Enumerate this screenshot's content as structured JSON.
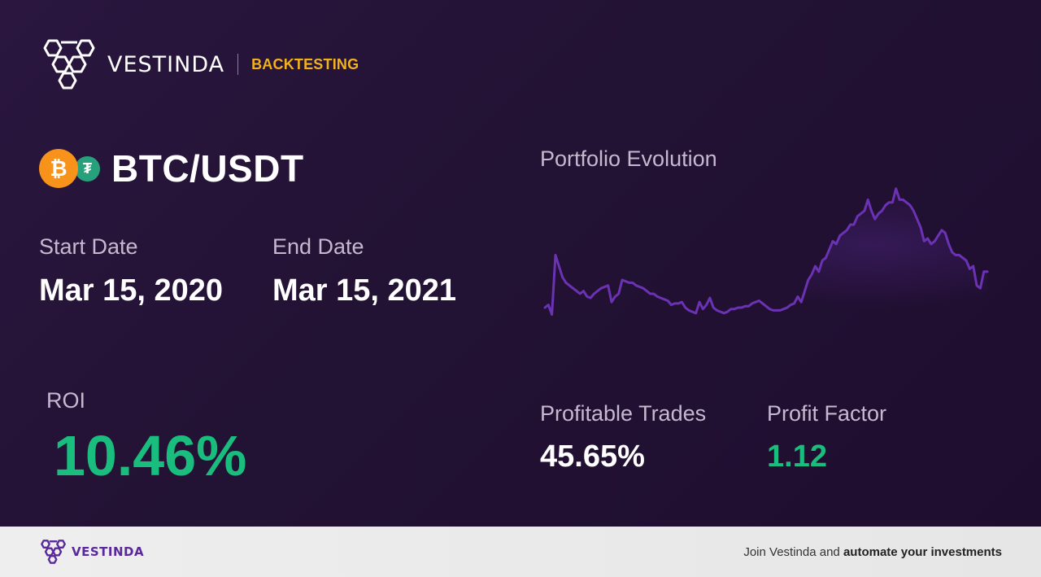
{
  "brand": {
    "name": "VESTINDA",
    "tag": "BACKTESTING",
    "tag_color": "#f2b21e"
  },
  "pair": {
    "name": "BTC/USDT",
    "base_icon": "bitcoin-icon",
    "base_glyph": "₿",
    "quote_icon": "tether-icon",
    "quote_glyph": "₮"
  },
  "dates": {
    "start_label": "Start Date",
    "start_value": "Mar 15, 2020",
    "end_label": "End Date",
    "end_value": "Mar 15, 2021"
  },
  "roi": {
    "label": "ROI",
    "value": "10.46%",
    "color": "#19be7e"
  },
  "stats": {
    "profitable_trades_label": "Profitable Trades",
    "profitable_trades_value": "45.65%",
    "profit_factor_label": "Profit Factor",
    "profit_factor_value": "1.12",
    "positive_color": "#19be7e"
  },
  "chart_data": {
    "type": "line",
    "title": "Portfolio Evolution",
    "xlabel": "",
    "ylabel": "",
    "grid": false,
    "line_color": "#6b32b4",
    "note": "No axes shown; values are relative portfolio level estimated from the line shape (arbitrary units, 0-100).",
    "ylim": [
      0,
      100
    ],
    "values": [
      10,
      12,
      5,
      48,
      40,
      32,
      28,
      26,
      24,
      22,
      20,
      22,
      18,
      17,
      20,
      22,
      24,
      25,
      26,
      14,
      18,
      20,
      30,
      29,
      28,
      28,
      26,
      25,
      24,
      22,
      20,
      20,
      18,
      17,
      16,
      15,
      12,
      13,
      13,
      14,
      10,
      8,
      7,
      6,
      14,
      9,
      12,
      17,
      10,
      8,
      7,
      6,
      7,
      9,
      9,
      10,
      10,
      11,
      11,
      13,
      14,
      15,
      13,
      11,
      9,
      8,
      8,
      8,
      9,
      10,
      12,
      13,
      18,
      14,
      22,
      30,
      34,
      40,
      36,
      44,
      46,
      52,
      58,
      56,
      62,
      64,
      66,
      70,
      70,
      76,
      78,
      80,
      88,
      80,
      74,
      78,
      80,
      84,
      86,
      86,
      96,
      88,
      88,
      86,
      84,
      80,
      74,
      68,
      58,
      60,
      56,
      58,
      62,
      66,
      64,
      56,
      50,
      48,
      48,
      46,
      44,
      38,
      40,
      26,
      24,
      36,
      36
    ]
  },
  "footer": {
    "brand_name": "VESTINDA",
    "cta_prefix": "Join Vestinda and ",
    "cta_bold": "automate your investments"
  }
}
